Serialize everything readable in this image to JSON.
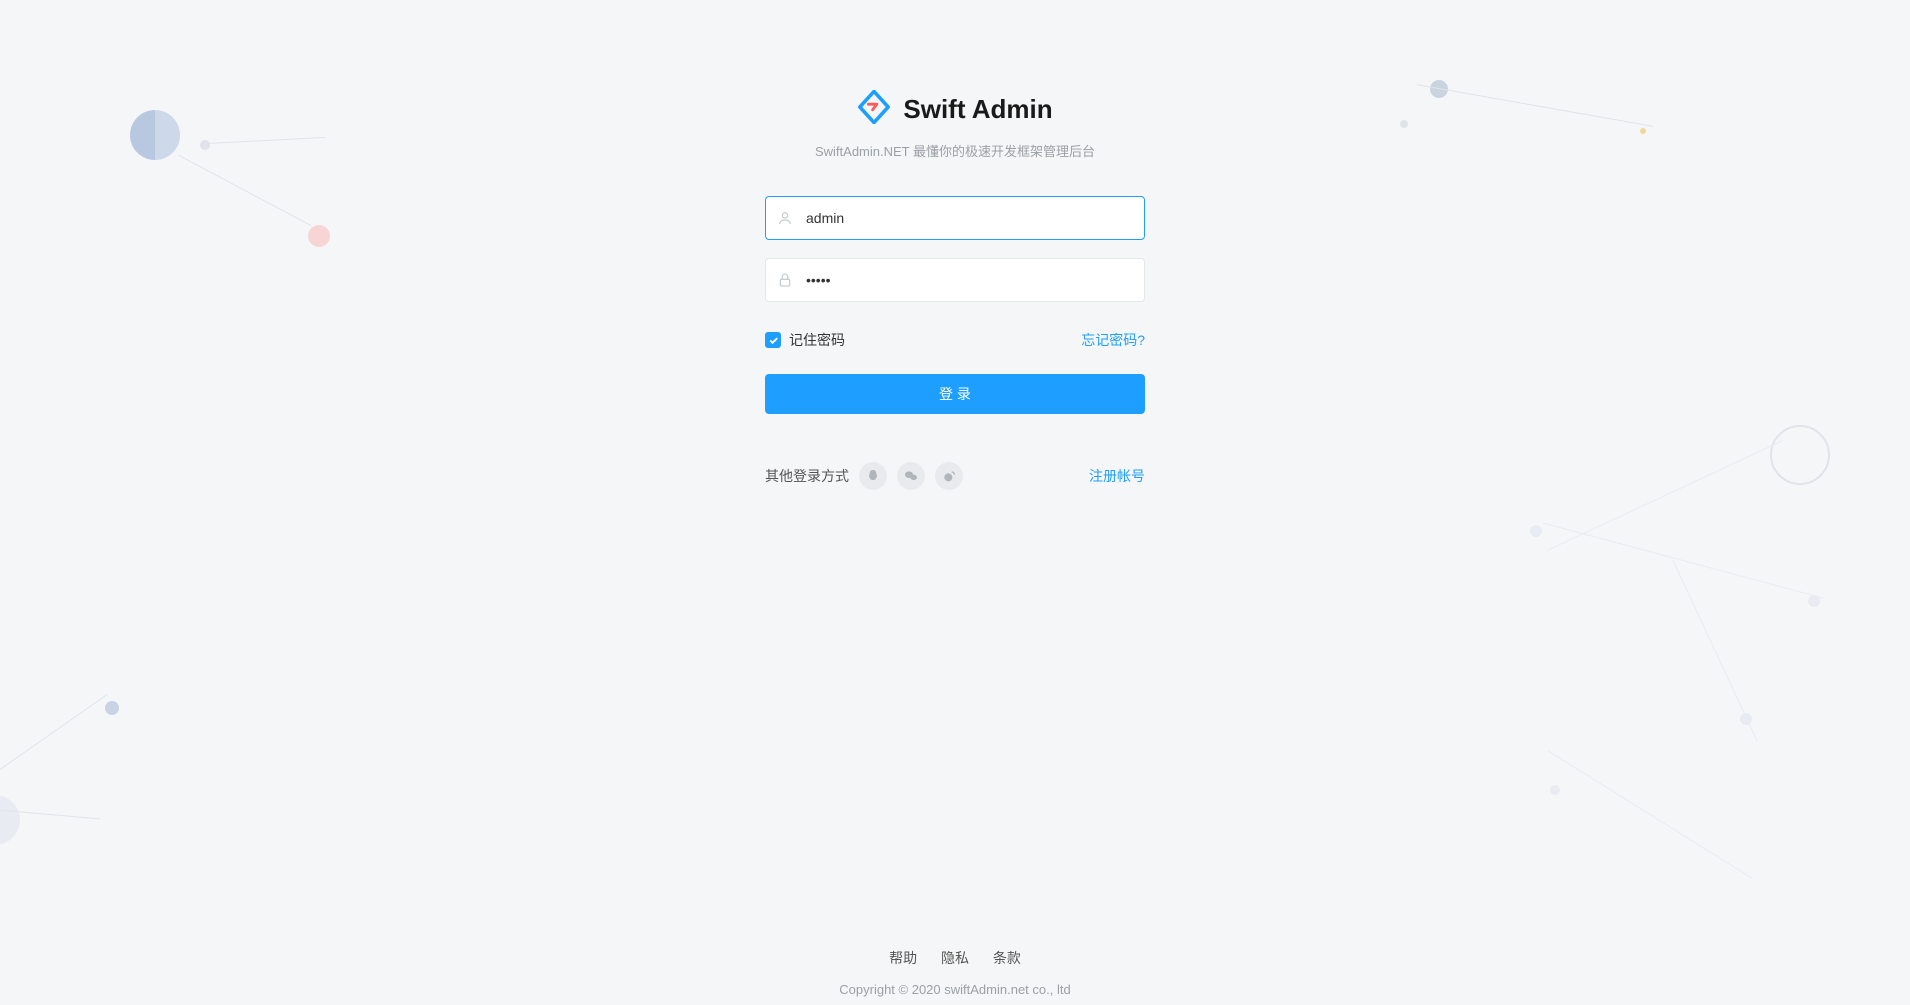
{
  "brand": {
    "title": "Swift Admin",
    "subtitle": "SwiftAdmin.NET 最懂你的极速开发框架管理后台"
  },
  "form": {
    "username_value": "admin",
    "password_value_mask": "•••••",
    "remember_label": "记住密码",
    "forgot_label": "忘记密码?",
    "submit_label": "登 录",
    "other_label": "其他登录方式",
    "register_label": "注册帐号"
  },
  "footer": {
    "links": [
      "帮助",
      "隐私",
      "条款"
    ],
    "copyright": "Copyright © 2020 swiftAdmin.net co., ltd"
  },
  "colors": {
    "accent": "#1e9fff"
  }
}
